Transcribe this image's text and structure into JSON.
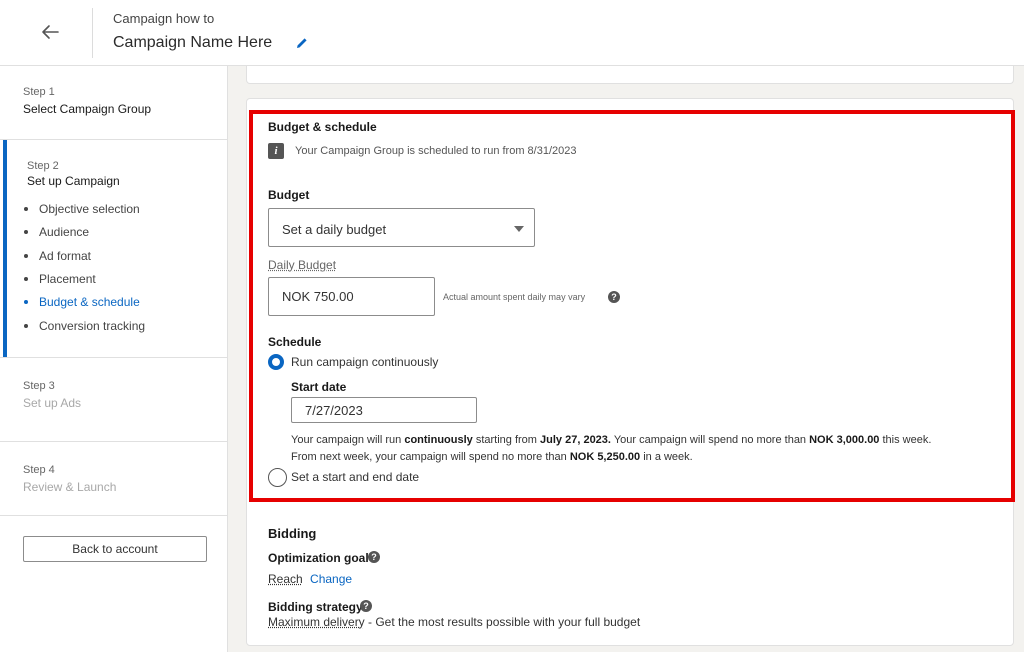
{
  "header": {
    "breadcrumb": "Campaign how to",
    "campaign_name": "Campaign Name Here"
  },
  "sidebar": {
    "steps": [
      {
        "num": "Step 1",
        "title": "Select Campaign Group"
      },
      {
        "num": "Step 2",
        "title": "Set up Campaign"
      },
      {
        "num": "Step 3",
        "title": "Set up Ads"
      },
      {
        "num": "Step 4",
        "title": "Review & Launch"
      }
    ],
    "substeps": [
      "Objective selection",
      "Audience",
      "Ad format",
      "Placement",
      "Budget & schedule",
      "Conversion tracking"
    ],
    "active_substep": "Budget & schedule",
    "back_label": "Back to account"
  },
  "budget": {
    "title": "Budget & schedule",
    "info": "Your Campaign Group is scheduled to run from 8/31/2023",
    "budget_label": "Budget",
    "budget_type": "Set a daily budget",
    "daily_label": "Daily Budget",
    "daily_value": "NOK 750.00",
    "daily_hint": "Actual amount spent daily may vary",
    "schedule_label": "Schedule",
    "option_continuous": "Run campaign continuously",
    "start_label": "Start date",
    "start_value": "7/27/2023",
    "summary": {
      "p1": "Your campaign will run ",
      "b1": "continuously",
      "p2": " starting from ",
      "b2": "July 27, 2023.",
      "p3": " Your campaign will spend no more than ",
      "b3": "NOK 3,000.00",
      "p4": " this week.",
      "p5": "From next week, your campaign will spend no more than ",
      "b4": "NOK 5,250.00",
      "p6": " in a week."
    },
    "option_range": "Set a start and end date"
  },
  "bidding": {
    "title": "Bidding",
    "goal_label": "Optimization goal",
    "goal_value": "Reach",
    "change_label": "Change",
    "strategy_label": "Bidding strategy",
    "strategy_value": "Maximum delivery",
    "strategy_desc": " - Get the most results possible with your full budget"
  },
  "colors": {
    "accent": "#0a66c2",
    "highlight": "#e60000"
  }
}
